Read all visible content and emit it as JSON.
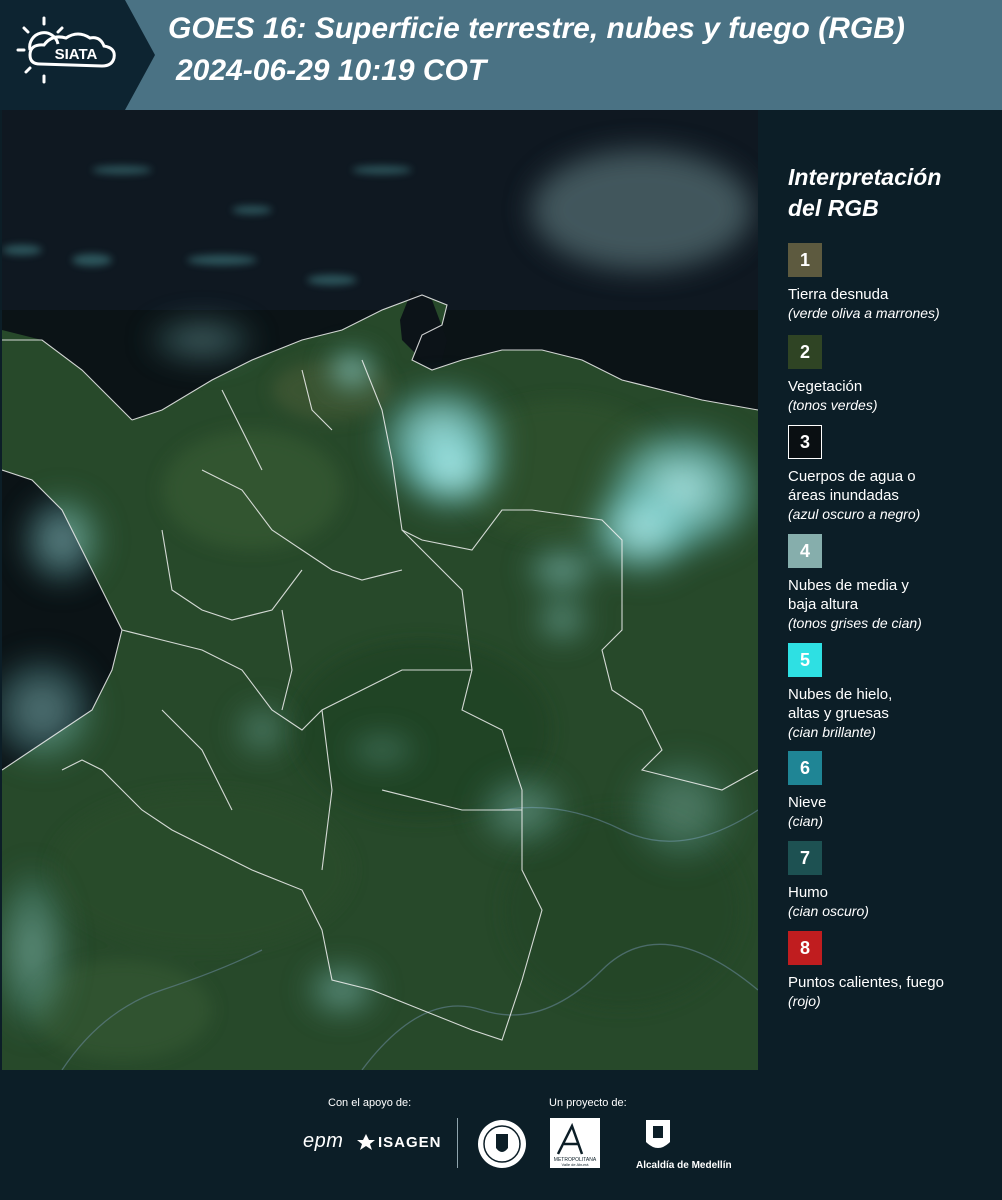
{
  "header": {
    "logo_text": "SIATA",
    "title": "GOES 16: Superficie terrestre, nubes y fuego (RGB)",
    "datetime": "2024-06-29 10:19 COT"
  },
  "legend": {
    "title_line1": "Interpretación",
    "title_line2": "del RGB",
    "items": [
      {
        "number": "1",
        "label": "Tierra desnuda",
        "desc": "(verde oliva a marrones)",
        "color": "#5d5a3f"
      },
      {
        "number": "2",
        "label": "Vegetación",
        "desc": "(tonos verdes)",
        "color": "#2f4424"
      },
      {
        "number": "3",
        "label": "Cuerpos de agua o\náreas inundadas",
        "desc": "(azul oscuro a negro)",
        "color": "#0a0f12"
      },
      {
        "number": "4",
        "label": "Nubes de media y\nbaja altura",
        "desc": "(tonos grises de cian)",
        "color": "#86aeac"
      },
      {
        "number": "5",
        "label": "Nubes de hielo,\naltas y gruesas",
        "desc": "(cian brillante)",
        "color": "#2ee0e3"
      },
      {
        "number": "6",
        "label": "Nieve",
        "desc": "(cian)",
        "color": "#1f8595"
      },
      {
        "number": "7",
        "label": "Humo",
        "desc": "(cian oscuro)",
        "color": "#1d5152"
      },
      {
        "number": "8",
        "label": "Puntos calientes, fuego",
        "desc": "(rojo)",
        "color": "#c01d1f"
      }
    ]
  },
  "footer": {
    "support_label": "Con el apoyo de:",
    "project_label": "Un proyecto de:",
    "epm": "epm",
    "isagen": "ISAGEN",
    "area_line1": "METROPOLITANA",
    "area_line2": "Valle de Aburrá",
    "alcaldia": "Alcaldía de Medellín"
  }
}
